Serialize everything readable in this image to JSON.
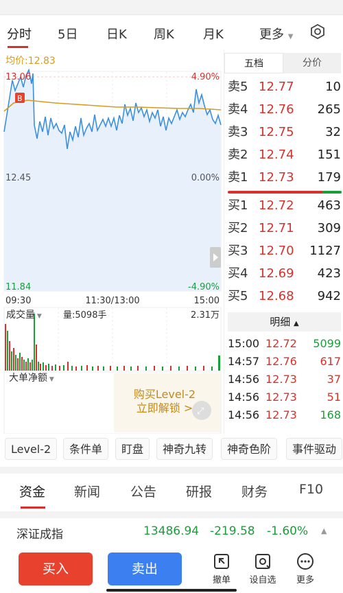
{
  "tabs": {
    "items": [
      "分时",
      "5日",
      "日K",
      "周K",
      "月K",
      "更多"
    ],
    "active": "分时"
  },
  "chart": {
    "vwap_label": "均价:12.83",
    "price_high": "13.06",
    "price_mid": "12.45",
    "price_low": "11.84",
    "pct_high": "4.90%",
    "pct_mid": "0.00%",
    "pct_low": "-4.90%",
    "time_start": "09:30",
    "time_mid": "11:30/13:00",
    "time_end": "15:00",
    "buy_marker": "B",
    "volume_dropdown": "成交量",
    "volume_value": "量:5098手",
    "volume_max": "2.31万",
    "bigorder_dropdown": "大单净额",
    "promo_line1": "购买Level-2",
    "promo_line2": "立即解锁 >",
    "line_color": "#3b8fe0",
    "vwap_color": "#d89b1c"
  },
  "order_book": {
    "tab_5level": "五档",
    "tab_fenjia": "分价",
    "asks": [
      {
        "label": "卖5",
        "price": "12.77",
        "vol": "10"
      },
      {
        "label": "卖4",
        "price": "12.76",
        "vol": "265"
      },
      {
        "label": "卖3",
        "price": "12.75",
        "vol": "32"
      },
      {
        "label": "卖2",
        "price": "12.74",
        "vol": "151"
      },
      {
        "label": "卖1",
        "price": "12.73",
        "vol": "179"
      }
    ],
    "bids": [
      {
        "label": "买1",
        "price": "12.72",
        "vol": "463"
      },
      {
        "label": "买2",
        "price": "12.71",
        "vol": "309"
      },
      {
        "label": "买3",
        "price": "12.70",
        "vol": "1127"
      },
      {
        "label": "买4",
        "price": "12.69",
        "vol": "423"
      },
      {
        "label": "买5",
        "price": "12.68",
        "vol": "942"
      }
    ],
    "mingxi_label": "明细",
    "ticks": [
      {
        "time": "15:00",
        "price": "12.72",
        "vol": "5099",
        "vol_color": "green"
      },
      {
        "time": "14:57",
        "price": "12.76",
        "vol": "617",
        "vol_color": "red"
      },
      {
        "time": "14:56",
        "price": "12.73",
        "vol": "37",
        "vol_color": "red"
      },
      {
        "time": "14:56",
        "price": "12.73",
        "vol": "51",
        "vol_color": "red"
      },
      {
        "time": "14:56",
        "price": "12.73",
        "vol": "168",
        "vol_color": "green"
      }
    ]
  },
  "chips": [
    "Level-2",
    "条件单",
    "盯盘",
    "神奇九转",
    "神奇色阶",
    "事件驱动"
  ],
  "news_tabs": {
    "items": [
      "资金",
      "新闻",
      "公告",
      "研报",
      "财务",
      "F10"
    ],
    "active": "资金"
  },
  "index_bar": {
    "name": "深证成指",
    "value": "13486.94",
    "change": "-219.58",
    "pct": "-1.60%"
  },
  "bottom_bar": {
    "buy": "买入",
    "sell": "卖出",
    "cancel": "撤单",
    "watchlist": "设自选",
    "more": "更多"
  }
}
